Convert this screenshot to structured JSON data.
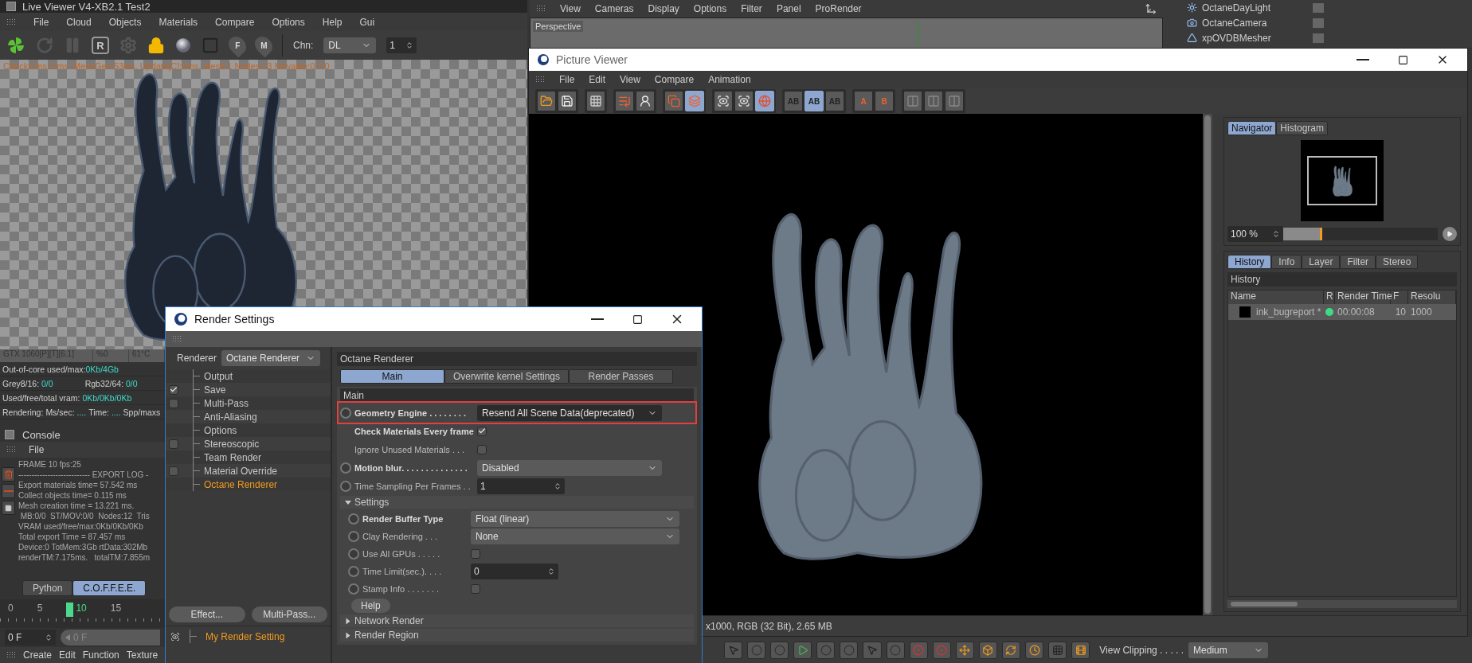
{
  "live_viewer": {
    "title": "Live Viewer V4-XB2.1 Test2",
    "menu": [
      "File",
      "Cloud",
      "Objects",
      "Materials",
      "Compare",
      "Options",
      "Help",
      "Gui"
    ],
    "toolbar": [
      {
        "kind": "logo"
      },
      {
        "kind": "refresh"
      },
      {
        "kind": "pause"
      },
      {
        "kind": "letter",
        "text": "R"
      },
      {
        "kind": "gear"
      },
      {
        "kind": "lock"
      },
      {
        "kind": "sphere"
      },
      {
        "kind": "frame"
      },
      {
        "kind": "pin",
        "text": "F"
      },
      {
        "kind": "pin",
        "text": "M"
      }
    ],
    "channel_label": "Chn:",
    "channel": "DL",
    "channel_count": "1",
    "stats": "Check:0ms./1ms. MeshGen:53ms. Update[C]:0ms. Mesh:1 Nodes:13 Movable:0  0 0",
    "gpu": [
      "GTX 1060[P][T][6.1]",
      "%0",
      "61°C"
    ],
    "readouts": [
      [
        {
          "label": "Out-of-core used/max:",
          "value": "0Kb/4Gb"
        }
      ],
      [
        {
          "label": "Grey8/16: ",
          "value": "0/0"
        },
        {
          "label": "Rgb32/64: ",
          "value": "0/0"
        }
      ],
      [
        {
          "label": "Used/free/total vram: ",
          "value": "0Kb/0Kb/0Kb"
        }
      ],
      [
        {
          "label": "Rendering:"
        },
        {
          "label": "Ms/sec: ",
          "value": "...."
        },
        {
          "label": "Time: ",
          "value": "...."
        },
        {
          "label": "Spp/maxs"
        }
      ]
    ]
  },
  "console": {
    "title": "Console",
    "menu": [
      "File"
    ],
    "lines": [
      "FRAME 10 fps:25",
      "--------------------------- EXPORT LOG -",
      "Export materials time= 57.542 ms",
      "Collect objects time= 0.115 ms",
      "Mesh creation time = 13.221 ms.",
      " MB:0/0  ST/MOV:0/0  Nodes:12  Tris",
      "VRAM used/free/max:0Kb/0Kb/0Kb",
      "Total export Time = 87.457 ms",
      "Device:0 TotMem:3Gb rtData:302Mb",
      "renderTM:7.175ms.   totalTM:7.855m"
    ],
    "tabs": [
      {
        "label": "Python",
        "selected": false
      },
      {
        "label": "C.O.F.F.E.E.",
        "selected": true
      }
    ]
  },
  "timeline": {
    "labels": [
      {
        "text": "0",
        "selected": false
      },
      {
        "text": "5",
        "selected": false
      },
      {
        "text": "10",
        "selected": true
      },
      {
        "text": "15",
        "selected": false
      }
    ],
    "frame": "0 F",
    "slider": "0 F"
  },
  "bottom_menu": [
    "Create",
    "Edit",
    "Function",
    "Texture"
  ],
  "viewport": {
    "menu": [
      "View",
      "Cameras",
      "Display",
      "Options",
      "Filter",
      "Panel",
      "ProRender"
    ],
    "view": "Perspective"
  },
  "object_manager": {
    "objects": [
      {
        "name": "OctaneDayLight",
        "kind": "light"
      },
      {
        "name": "OctaneCamera",
        "kind": "camera"
      },
      {
        "name": "xpOVDBMesher",
        "kind": "mesher"
      }
    ]
  },
  "picture_viewer": {
    "title": "Picture Viewer",
    "menu": [
      "File",
      "Edit",
      "View",
      "Compare",
      "Animation"
    ],
    "toolbar": [
      [
        {
          "kind": "open",
          "selected": false
        },
        {
          "kind": "save",
          "selected": false
        }
      ],
      [
        {
          "kind": "grid",
          "selected": false
        }
      ],
      [
        {
          "kind": "export",
          "selected": false
        },
        {
          "kind": "person",
          "selected": false
        }
      ],
      [
        {
          "kind": "copy",
          "selected": false
        },
        {
          "kind": "layers",
          "selected": true
        }
      ],
      [
        {
          "kind": "view",
          "selected": false
        },
        {
          "kind": "view",
          "selected": false
        },
        {
          "kind": "view_sphere",
          "selected": true
        }
      ],
      [
        {
          "kind": "ab",
          "text": "AB",
          "selected": false
        },
        {
          "kind": "ab",
          "text": "AB",
          "selected": true
        },
        {
          "kind": "ab",
          "text": "AB",
          "selected": false
        }
      ],
      [
        {
          "kind": "arrow_letter",
          "text": "A",
          "selected": false
        },
        {
          "kind": "arrow_letter",
          "text": "B",
          "selected": false
        }
      ],
      [
        {
          "kind": "split",
          "selected": false
        },
        {
          "kind": "split",
          "selected": false
        },
        {
          "kind": "split",
          "selected": false
        }
      ]
    ],
    "navigator_tabs": [
      {
        "label": "Navigator",
        "selected": true
      },
      {
        "label": "Histogram",
        "selected": false
      }
    ],
    "zoom": "100 %",
    "zoom_level": {
      "level": 0.25
    },
    "info_tabs": [
      {
        "label": "History",
        "selected": true
      },
      {
        "label": "Info",
        "selected": false
      },
      {
        "label": "Layer",
        "selected": false
      },
      {
        "label": "Filter",
        "selected": false
      },
      {
        "label": "Stereo",
        "selected": false
      }
    ],
    "history_title": "History",
    "columns": [
      "Name",
      "R",
      "Render Time",
      "F",
      "Resolu"
    ],
    "rows": [
      {
        "name": "ink_bugreport *",
        "color": "#3ddc84",
        "time": "00:00:08",
        "frame": "10",
        "resolution": "1000",
        "selected": true
      }
    ],
    "status": "x1000, RGB (32 Bit), 2.65 MB"
  },
  "attributes": {
    "tools": [
      {
        "kind": "cursor"
      },
      {
        "kind": "round"
      },
      {
        "kind": "round"
      },
      {
        "kind": "play"
      },
      {
        "kind": "round"
      },
      {
        "kind": "round"
      },
      {
        "kind": "cursor"
      },
      {
        "kind": "round"
      },
      {
        "kind": "record"
      },
      {
        "kind": "record"
      },
      {
        "kind": "move"
      },
      {
        "kind": "box"
      },
      {
        "kind": "rotate"
      },
      {
        "kind": "clock"
      },
      {
        "kind": "dots"
      },
      {
        "kind": "film"
      }
    ],
    "label": "View Clipping . . . . .",
    "value": "Medium"
  },
  "render_settings": {
    "title": "Render Settings",
    "renderer_label": "Renderer",
    "renderer": "Octane Renderer",
    "tree": [
      {
        "label": "Output",
        "kind": "plain",
        "selected": false
      },
      {
        "label": "Save",
        "kind": "check",
        "checked": true,
        "selected": false
      },
      {
        "label": "Multi-Pass",
        "kind": "check",
        "checked": false,
        "selected": false
      },
      {
        "label": "Anti-Aliasing",
        "kind": "plain",
        "selected": false
      },
      {
        "label": "Options",
        "kind": "plain",
        "selected": false
      },
      {
        "label": "Stereoscopic",
        "kind": "check",
        "checked": false,
        "selected": false
      },
      {
        "label": "Team Render",
        "kind": "plain",
        "selected": false
      },
      {
        "label": "Material Override",
        "kind": "check",
        "checked": false,
        "selected": false
      },
      {
        "label": "Octane Renderer",
        "kind": "plain",
        "selected": true
      }
    ],
    "buttons": [
      "Effect...",
      "Multi-Pass..."
    ],
    "setting": "My Render Setting",
    "header": "Octane Renderer",
    "tabs": [
      {
        "label": "Main",
        "selected": true
      },
      {
        "label": "Overwrite kernel Settings",
        "selected": false
      },
      {
        "label": "Render Passes",
        "selected": false
      }
    ],
    "section": "Main",
    "params": [
      {
        "kind": "dropdown",
        "label": "Geometry Engine . . . . . . . .",
        "value": "Resend All Scene Data(deprecated)",
        "keyframe": true,
        "strong": true,
        "highlighted": true
      },
      {
        "kind": "checkbox",
        "label": "Check Materials Every frame",
        "checked": true,
        "keyframe": false,
        "strong": true
      },
      {
        "kind": "checkbox",
        "label": "Ignore Unused Materials . . .",
        "checked": false,
        "keyframe": false,
        "strong": false
      },
      {
        "kind": "dropdown",
        "label": "Motion blur. . . . . . . . . . . . . .",
        "value": "Disabled",
        "keyframe": true,
        "strong": true,
        "highlighted": false
      },
      {
        "kind": "number",
        "label": "Time Sampling Per Frames . .",
        "value": "1",
        "keyframe": true,
        "strong": false
      }
    ],
    "group": {
      "label": "Settings",
      "expanded": true,
      "params": [
        {
          "kind": "dropdown",
          "label": "Render Buffer Type",
          "value": "Float (linear)",
          "keyframe": true,
          "strong": true,
          "highlighted": false
        },
        {
          "kind": "dropdown",
          "label": "Clay Rendering . . .",
          "value": "None",
          "keyframe": true,
          "strong": false,
          "highlighted": false
        },
        {
          "kind": "checkbox",
          "label": "Use All GPUs . . . . .",
          "checked": false,
          "keyframe": true,
          "strong": false
        },
        {
          "kind": "number",
          "label": "Time Limit(sec.). . . .",
          "value": "0",
          "keyframe": true,
          "strong": false
        },
        {
          "kind": "checkbox",
          "label": "Stamp Info . . . . . . .",
          "checked": false,
          "keyframe": true,
          "strong": false
        }
      ]
    },
    "help": "Help",
    "collapsed": [
      {
        "label": "Network Render",
        "expanded": false
      },
      {
        "label": "Render Region",
        "expanded": false
      }
    ]
  }
}
